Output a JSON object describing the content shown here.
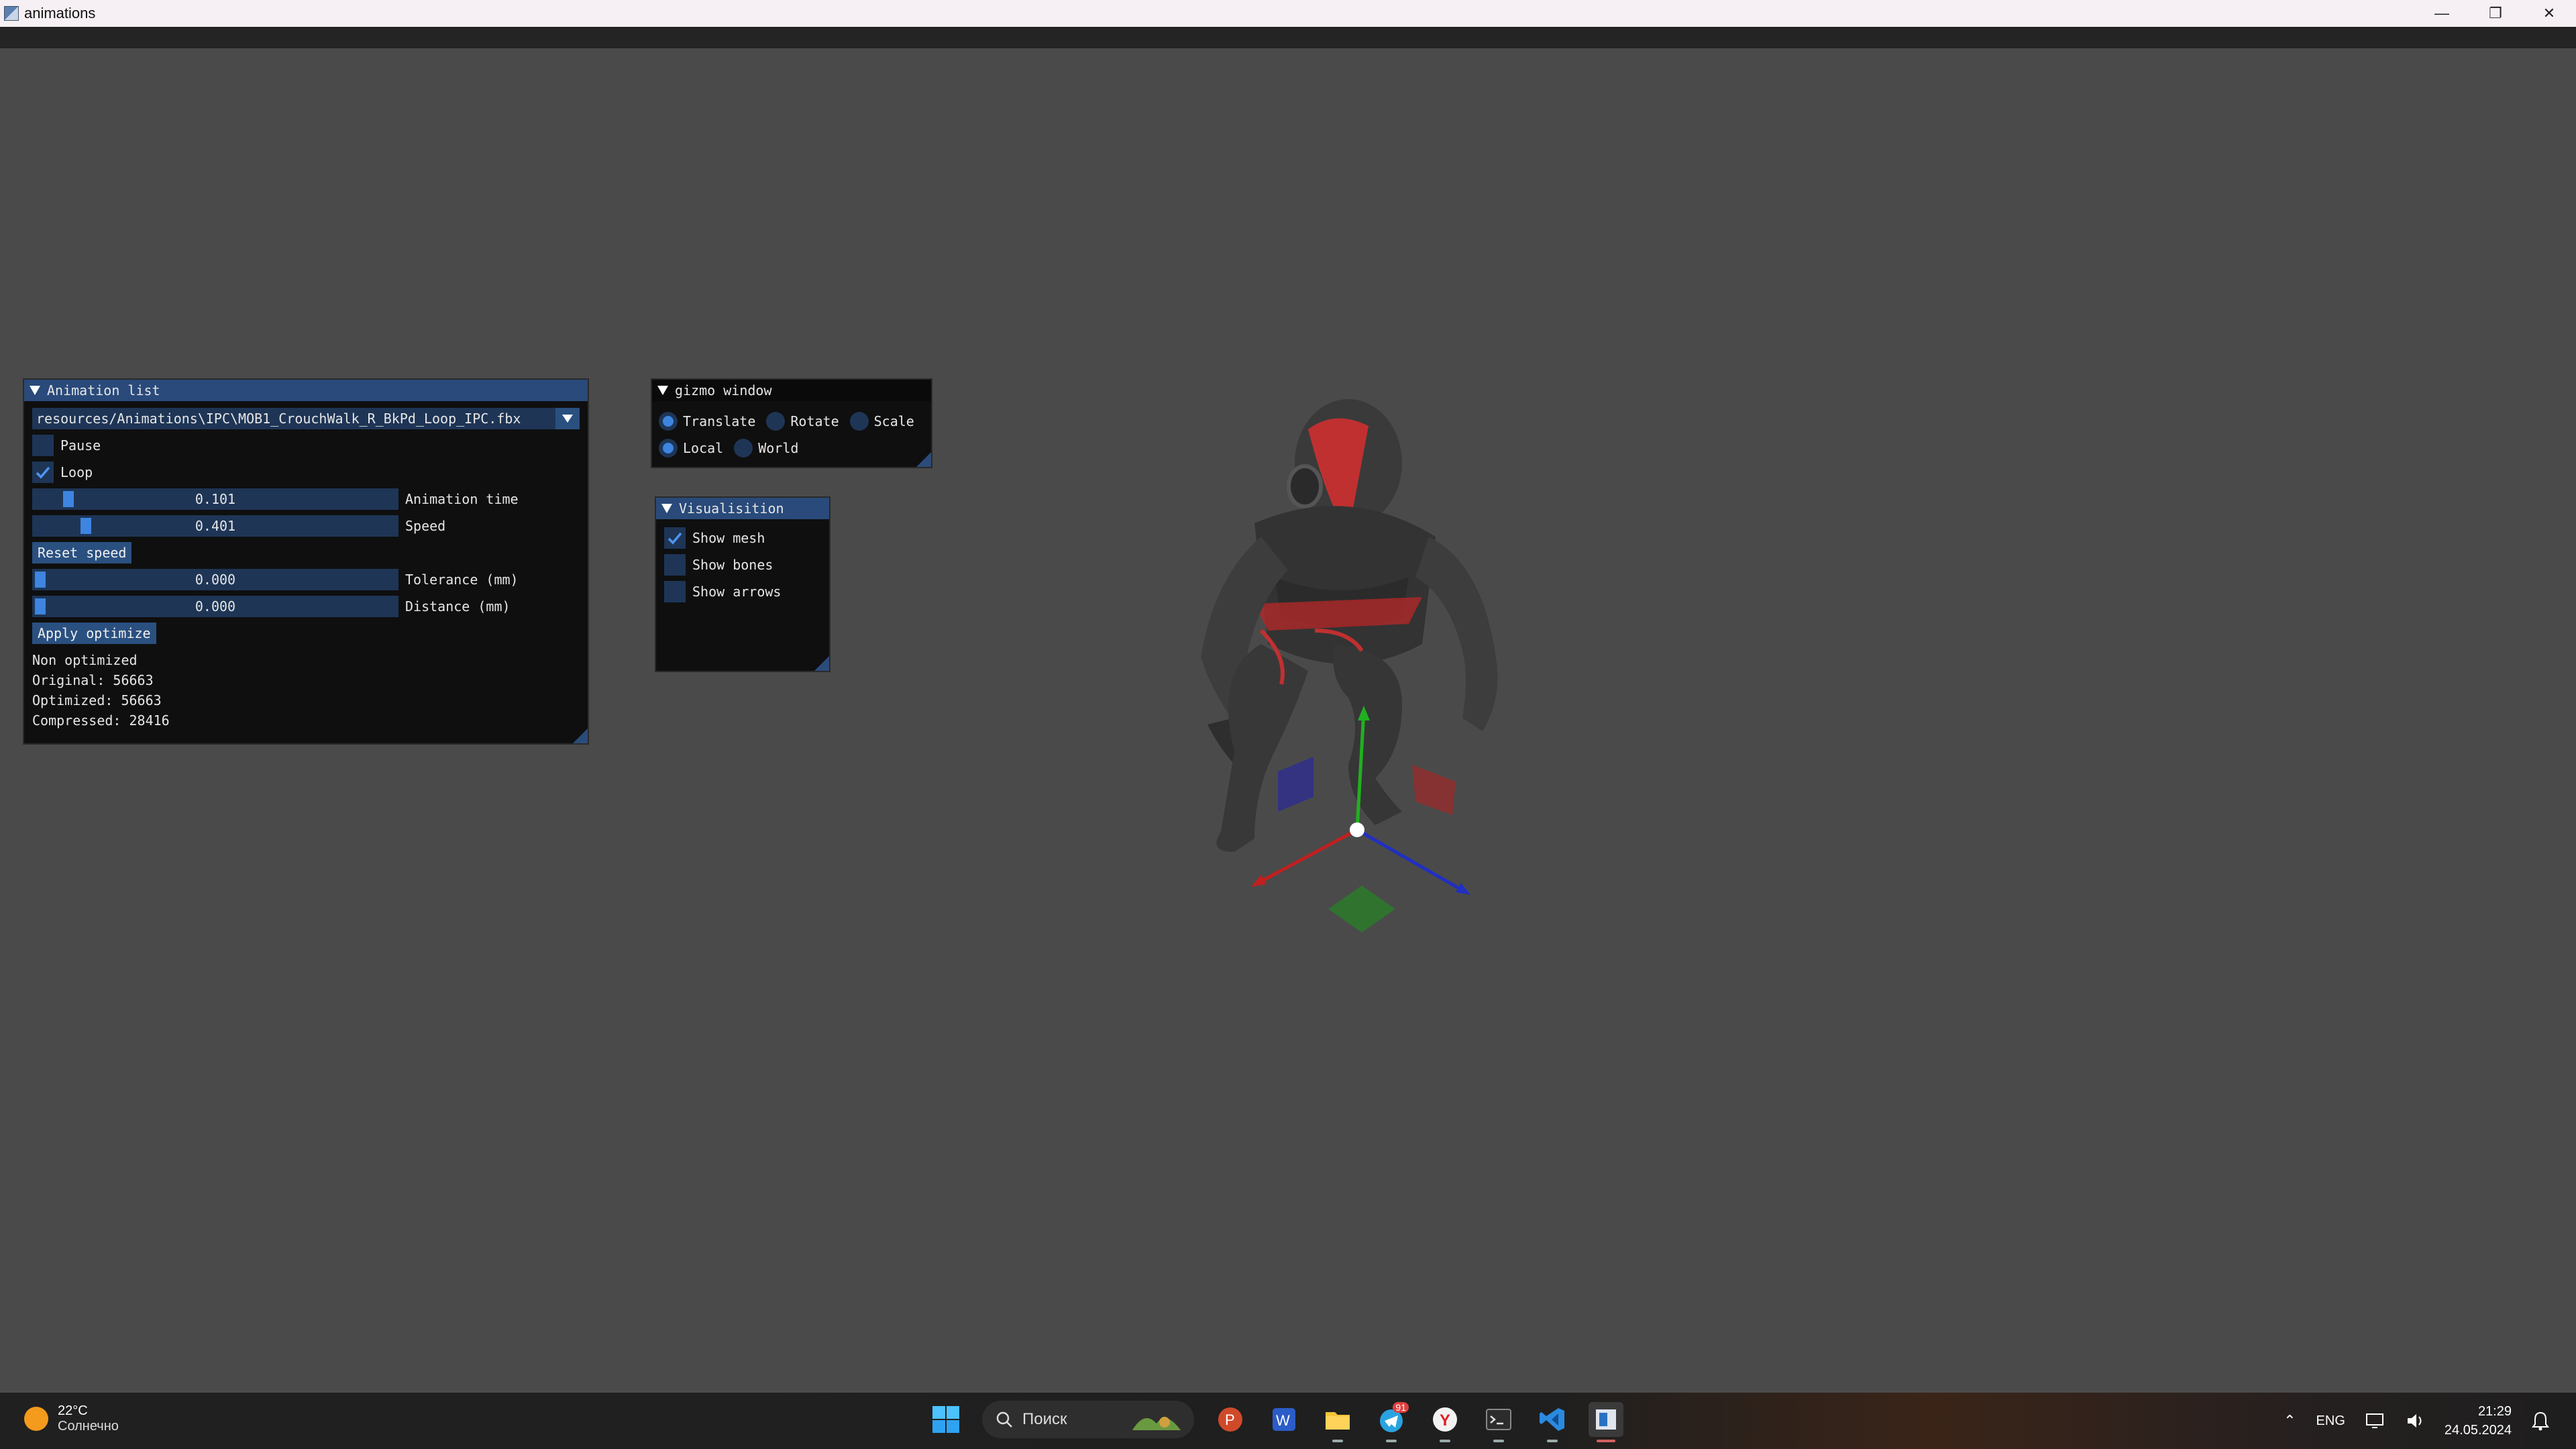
{
  "window": {
    "title": "animations",
    "controls": [
      "—",
      "❐",
      "✕"
    ]
  },
  "animation_list": {
    "title": "Animation list",
    "file": "resources/Animations\\IPC\\MOB1_CrouchWalk_R_BkPd_Loop_IPC.fbx",
    "pause": {
      "label": "Pause",
      "checked": false
    },
    "loop": {
      "label": "Loop",
      "checked": true
    },
    "animation_time": {
      "value": "0.101",
      "label": "Animation time"
    },
    "speed": {
      "value": "0.401",
      "label": "Speed"
    },
    "reset_speed": "Reset speed",
    "tolerance": {
      "value": "0.000",
      "label": "Tolerance (mm)"
    },
    "distance": {
      "value": "0.000",
      "label": "Distance (mm)"
    },
    "apply_optimize": "Apply optimize",
    "status": "Non optimized",
    "original": "Original: 56663",
    "optimized": "Optimized: 56663",
    "compressed": "Compressed: 28416"
  },
  "gizmo_window": {
    "title": "gizmo window",
    "translate": "Translate",
    "rotate": "Rotate",
    "scale": "Scale",
    "local": "Local",
    "world": "World",
    "selected_operation": "Translate",
    "selected_space": "Local"
  },
  "visualisation": {
    "title": "Visualisition",
    "show_mesh": {
      "label": "Show mesh",
      "checked": true
    },
    "show_bones": {
      "label": "Show bones",
      "checked": false
    },
    "show_arrows": {
      "label": "Show arrows",
      "checked": false
    }
  },
  "taskbar": {
    "temperature": "22°C",
    "weather": "Солнечно",
    "search_placeholder": "Поиск",
    "telegram_badge": "91",
    "language": "ENG",
    "time": "21:29",
    "date": "24.05.2024"
  },
  "colors": {
    "viewport": "#4a4a4a",
    "imgui_accent": "#3d85e0",
    "imgui_frame": "#1e3556"
  }
}
